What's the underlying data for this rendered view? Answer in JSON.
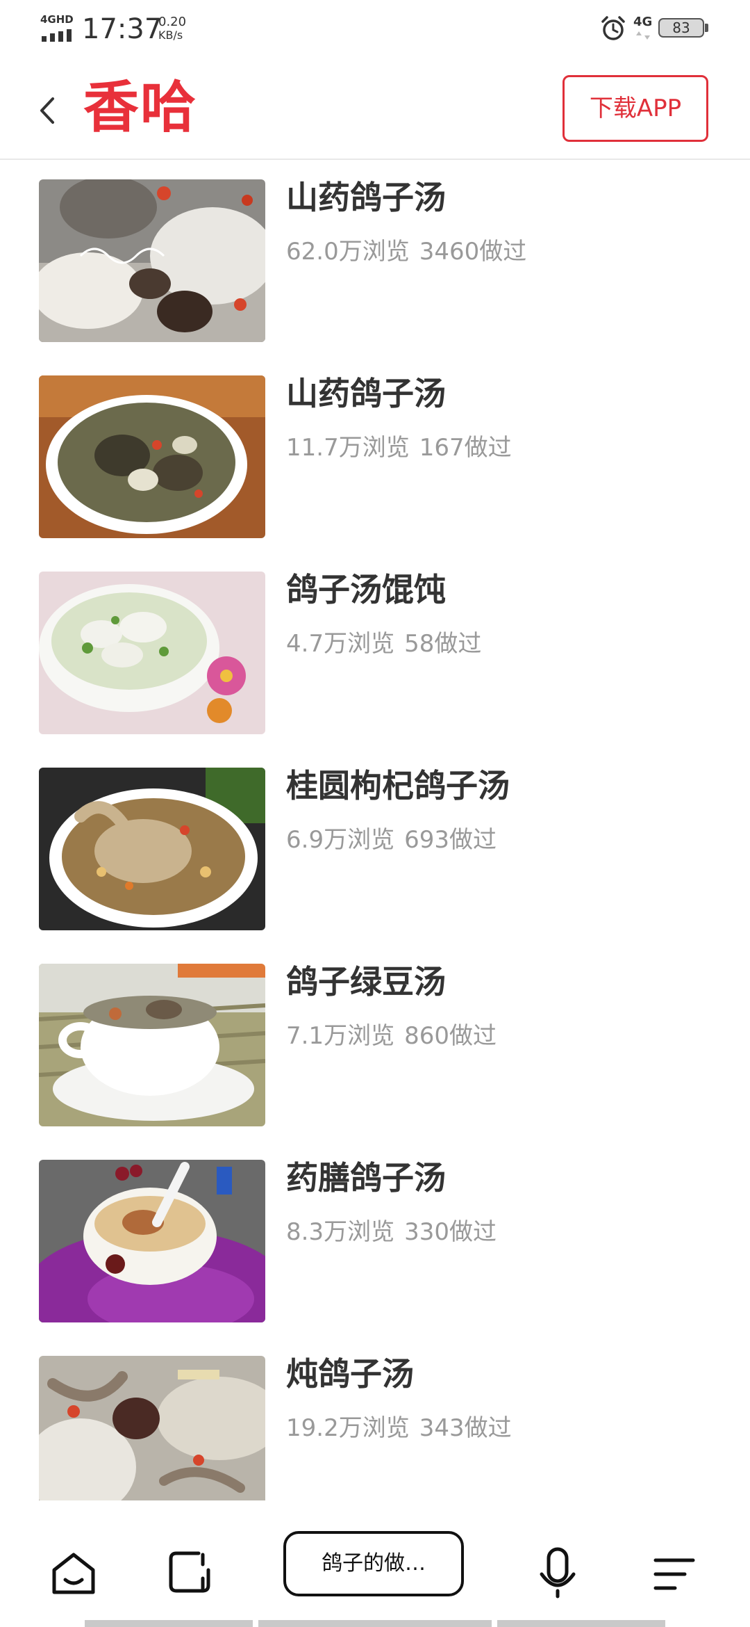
{
  "status_bar": {
    "network": "4GHD",
    "time": "17:37",
    "speed_value": "0.20",
    "speed_unit": "KB/s",
    "mobile_data": "4G",
    "battery": "83"
  },
  "header": {
    "logo": "香哈",
    "download_label": "下载APP"
  },
  "recipes": [
    {
      "title": "山药鸽子汤",
      "views": "62.0万浏览",
      "made": "3460做过"
    },
    {
      "title": "山药鸽子汤",
      "views": "11.7万浏览",
      "made": "167做过"
    },
    {
      "title": "鸽子汤馄饨",
      "views": "4.7万浏览",
      "made": "58做过"
    },
    {
      "title": "桂圆枸杞鸽子汤",
      "views": "6.9万浏览",
      "made": "693做过"
    },
    {
      "title": "鸽子绿豆汤",
      "views": "7.1万浏览",
      "made": "860做过"
    },
    {
      "title": "药膳鸽子汤",
      "views": "8.3万浏览",
      "made": "330做过"
    },
    {
      "title": "炖鸽子汤",
      "views": "19.2万浏览",
      "made": "343做过"
    }
  ],
  "bottom_bar": {
    "search_text": "鸽子的做…",
    "icons": [
      "home-icon",
      "tabs-icon",
      "voice-icon",
      "menu-icon"
    ]
  },
  "colors": {
    "brand": "#e8303a",
    "title_text": "#333333",
    "meta_text": "#999999"
  }
}
